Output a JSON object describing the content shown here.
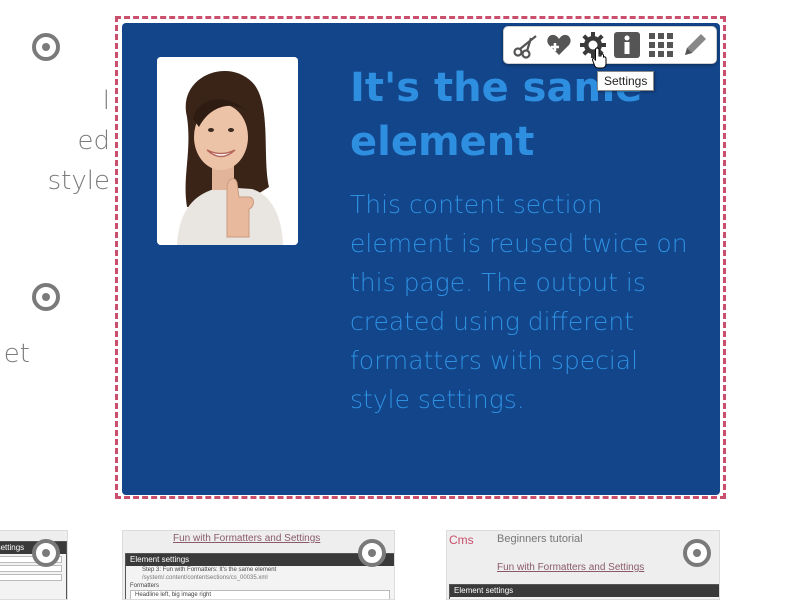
{
  "left_column": {
    "block1_lines": [
      "l",
      "ed",
      "style"
    ],
    "block2_lines": [
      "et"
    ]
  },
  "card": {
    "heading": "It's the same element",
    "body": "This content section element is reused twice on this page. The output is created using different formatters with special style settings.",
    "image_alt": "Smiling woman giving thumbs up"
  },
  "toolbar": {
    "tools": [
      "scissors-icon",
      "heart-plus-icon",
      "gear-icon",
      "info-icon",
      "grid-icon",
      "pencil-icon"
    ],
    "tooltip": "Settings"
  },
  "thumbnails": {
    "thumb1": {
      "dialog_title": "Element settings"
    },
    "thumb2": {
      "nav_link": "Fun with Formatters and Settings",
      "dialog_title": "Element settings",
      "row1": "Step 3: Fun with Formatters: It's the same element",
      "row2": "/system/.content/contentsections/cs_00035.xml",
      "row3": "Formatters",
      "row4": "Headline left, big image right"
    },
    "thumb3": {
      "logo": "Cms",
      "nav_title": "Beginners tutorial",
      "nav_link": "Fun with Formatters and Settings",
      "dialog_title": "Element settings"
    }
  },
  "colors": {
    "card_bg": "#12458a",
    "card_text": "#2e8fe0",
    "outline": "#c94f6d"
  }
}
